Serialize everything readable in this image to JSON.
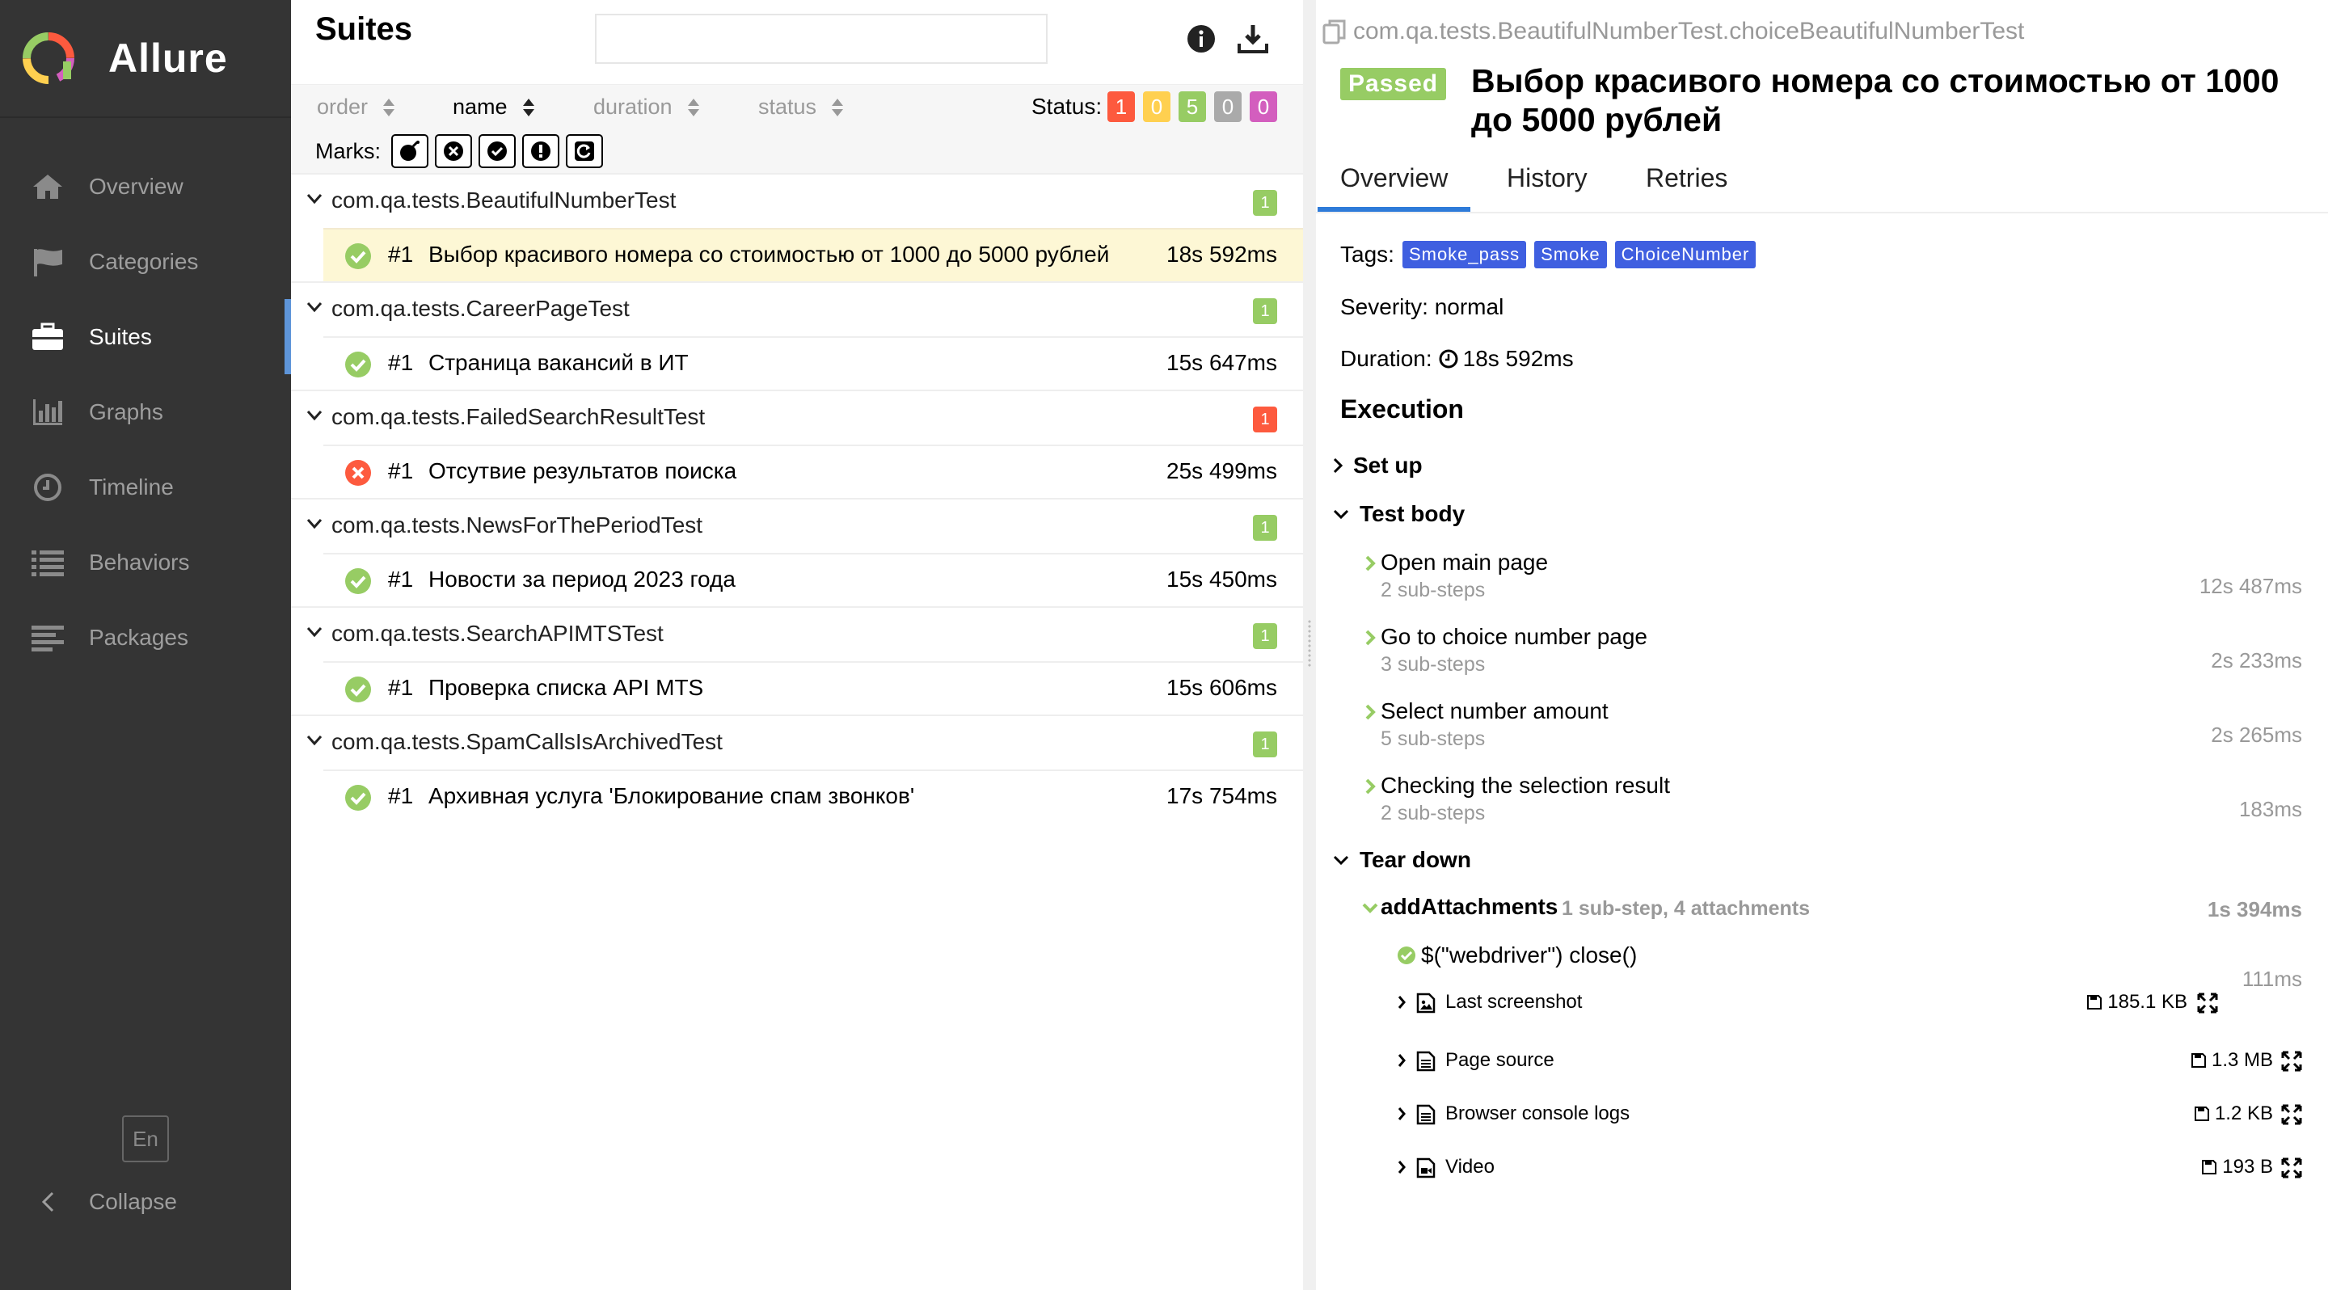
{
  "sidebar": {
    "brand": "Allure",
    "items": [
      {
        "label": "Overview",
        "icon": "home-icon"
      },
      {
        "label": "Categories",
        "icon": "flag-icon"
      },
      {
        "label": "Suites",
        "icon": "briefcase-icon"
      },
      {
        "label": "Graphs",
        "icon": "bar-chart-icon"
      },
      {
        "label": "Timeline",
        "icon": "clock-icon"
      },
      {
        "label": "Behaviors",
        "icon": "list-icon"
      },
      {
        "label": "Packages",
        "icon": "align-left-icon"
      }
    ],
    "active_index": 2,
    "lang": "En",
    "collapse": "Collapse"
  },
  "suites": {
    "title": "Suites",
    "search_placeholder": "",
    "sort": {
      "order": "order",
      "name": "name",
      "duration": "duration",
      "status": "status"
    },
    "status_label": "Status:",
    "status_counts": [
      {
        "value": "1",
        "color": "#fd5a3e"
      },
      {
        "value": "0",
        "color": "#ffd050"
      },
      {
        "value": "5",
        "color": "#97cc64"
      },
      {
        "value": "0",
        "color": "#aaaaaa"
      },
      {
        "value": "0",
        "color": "#d35ebe"
      }
    ],
    "marks_label": "Marks:",
    "groups": [
      {
        "name": "com.qa.tests.BeautifulNumberTest",
        "count": "1",
        "status": "passed",
        "test": {
          "num": "#1",
          "name": "Выбор красивого номера со стоимостью от 1000 до 5000 рублей",
          "duration": "18s 592ms",
          "status": "passed"
        }
      },
      {
        "name": "com.qa.tests.CareerPageTest",
        "count": "1",
        "status": "passed",
        "test": {
          "num": "#1",
          "name": "Страница вакансий в ИТ",
          "duration": "15s 647ms",
          "status": "passed"
        }
      },
      {
        "name": "com.qa.tests.FailedSearchResultTest",
        "count": "1",
        "status": "failed",
        "test": {
          "num": "#1",
          "name": "Отсутвие результатов поиска",
          "duration": "25s 499ms",
          "status": "failed"
        }
      },
      {
        "name": "com.qa.tests.NewsForThePeriodTest",
        "count": "1",
        "status": "passed",
        "test": {
          "num": "#1",
          "name": "Новости за период 2023 года",
          "duration": "15s 450ms",
          "status": "passed"
        }
      },
      {
        "name": "com.qa.tests.SearchAPIMTSTest",
        "count": "1",
        "status": "passed",
        "test": {
          "num": "#1",
          "name": "Проверка списка API MTS",
          "duration": "15s 606ms",
          "status": "passed"
        }
      },
      {
        "name": "com.qa.tests.SpamCallsIsArchivedTest",
        "count": "1",
        "status": "passed",
        "test": {
          "num": "#1",
          "name": "Архивная услуга 'Блокирование спам звонков'",
          "duration": "17s 754ms",
          "status": "passed"
        }
      }
    ]
  },
  "detail": {
    "full_name": "com.qa.tests.BeautifulNumberTest.choiceBeautifulNumberTest",
    "status_badge": "Passed",
    "title": "Выбор красивого номера со стоимостью от 1000 до 5000 рублей",
    "tabs": [
      "Overview",
      "History",
      "Retries"
    ],
    "tags_label": "Tags:",
    "tags": [
      "Smoke_pass",
      "Smoke",
      "ChoiceNumber"
    ],
    "severity": "Severity: normal",
    "duration_label": "Duration:",
    "duration": "18s 592ms",
    "execution": "Execution",
    "setup": "Set up",
    "test_body": "Test body",
    "steps": [
      {
        "name": "Open main page",
        "sub": "2 sub-steps",
        "duration": "12s 487ms"
      },
      {
        "name": "Go to choice number page",
        "sub": "3 sub-steps",
        "duration": "2s 233ms"
      },
      {
        "name": "Select number amount",
        "sub": "5 sub-steps",
        "duration": "2s 265ms"
      },
      {
        "name": "Checking the selection result",
        "sub": "2 sub-steps",
        "duration": "183ms"
      }
    ],
    "tear_down": "Tear down",
    "add_attachments": {
      "name": "addAttachments",
      "meta": "1 sub-step, 4 attachments",
      "duration": "1s 394ms"
    },
    "close_step": {
      "name": "$(\"webdriver\") close()",
      "duration": "111ms"
    },
    "attachments": [
      {
        "name": "Last screenshot",
        "size": "185.1 KB",
        "icon": "image-file-icon"
      },
      {
        "name": "Page source",
        "size": "1.3 MB",
        "icon": "text-file-icon"
      },
      {
        "name": "Browser console logs",
        "size": "1.2 KB",
        "icon": "text-file-icon"
      },
      {
        "name": "Video",
        "size": "193 B",
        "icon": "video-file-icon"
      }
    ]
  }
}
